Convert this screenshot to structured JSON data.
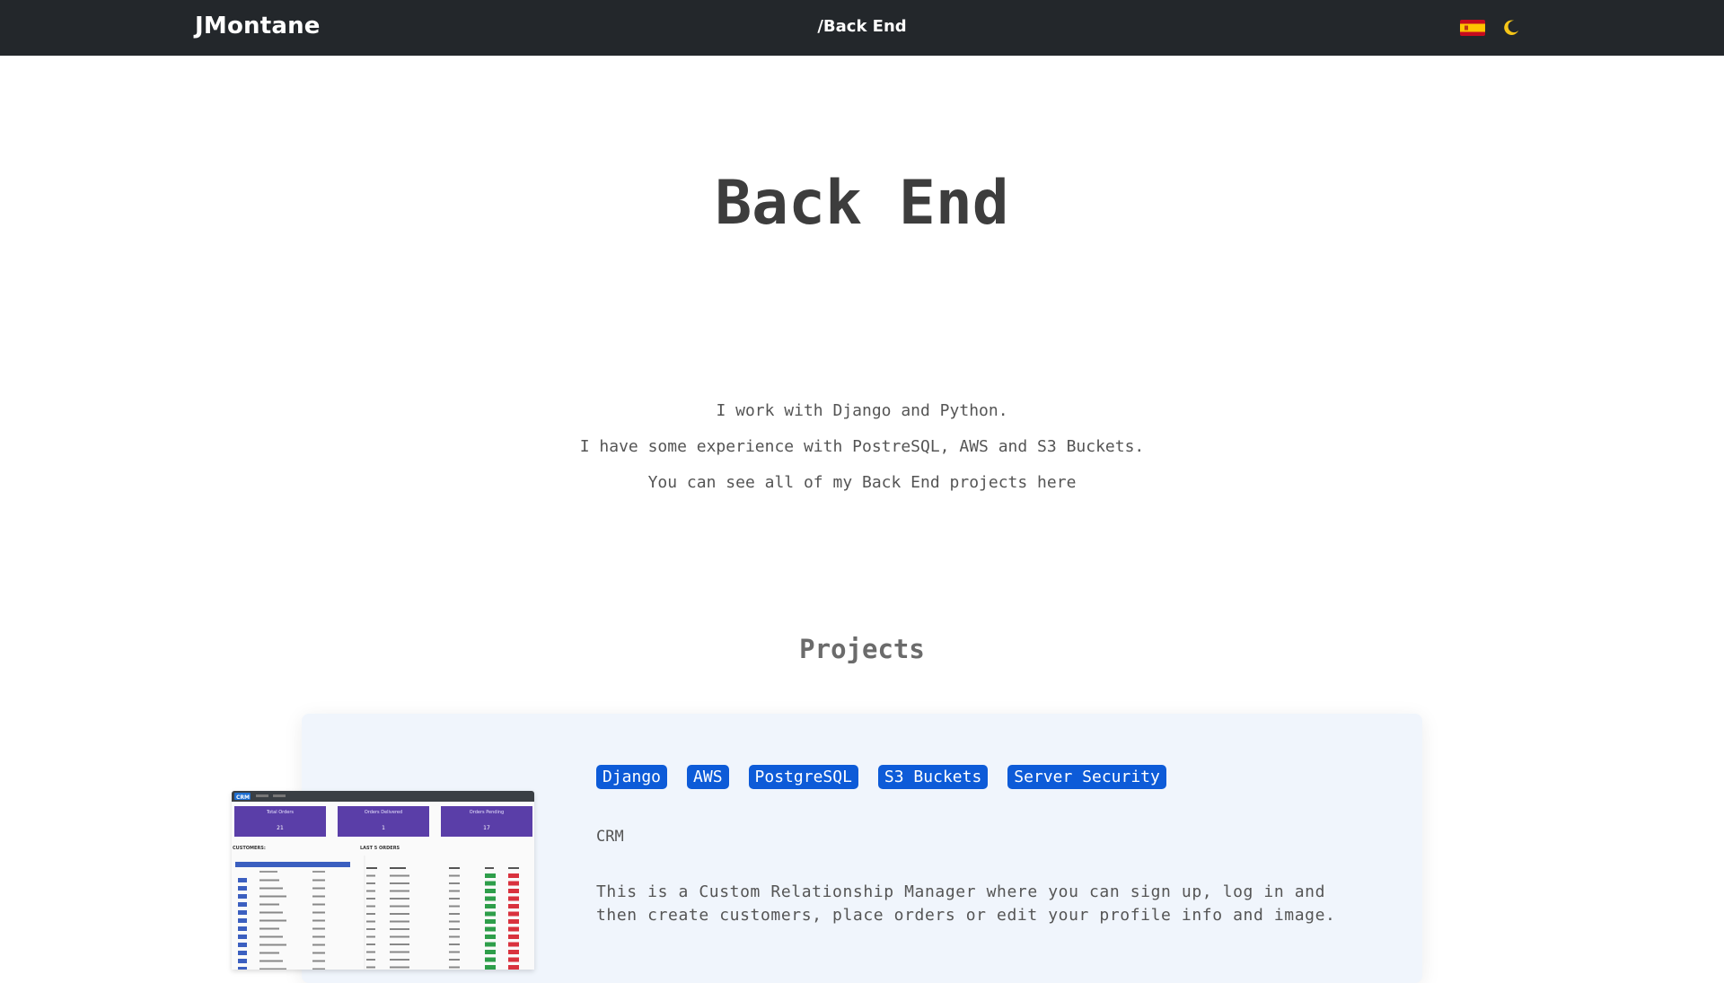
{
  "navbar": {
    "brand": "JMontane",
    "current_page": "/Back End",
    "language_flag_icon": "spain-flag-icon",
    "theme_icon": "moon-icon",
    "theme_icon_color": "#f5c518"
  },
  "hero": {
    "title": "Back End"
  },
  "intro": {
    "line1": "I work with Django and Python.",
    "line2": "I have some experience with PostreSQL, AWS and S3 Buckets.",
    "line3": "You can see all of my Back End projects here"
  },
  "projects": {
    "title": "Projects",
    "items": [
      {
        "tags": [
          "Django",
          "AWS",
          "PostgreSQL",
          "S3 Buckets",
          "Server Security"
        ],
        "name": "CRM",
        "description_line1": "This is a Custom Relationship Manager where you can sign up, log in and",
        "description_line2": "then create customers, place orders or edit your profile info and image.",
        "screenshot": {
          "logo": "CRM",
          "stats": [
            {
              "label": "Total Orders",
              "value": "21"
            },
            {
              "label": "Orders Delivered",
              "value": "1"
            },
            {
              "label": "Orders Pending",
              "value": "17"
            }
          ],
          "customers_label": "CUSTOMERS:",
          "orders_label": "LAST 5 ORDERS"
        }
      }
    ]
  },
  "colors": {
    "navbar_bg": "#23272b",
    "tag_bg": "#0d5bd8",
    "card_bg": "#f0f5fc",
    "stat_card_bg": "#5a3ea8"
  }
}
